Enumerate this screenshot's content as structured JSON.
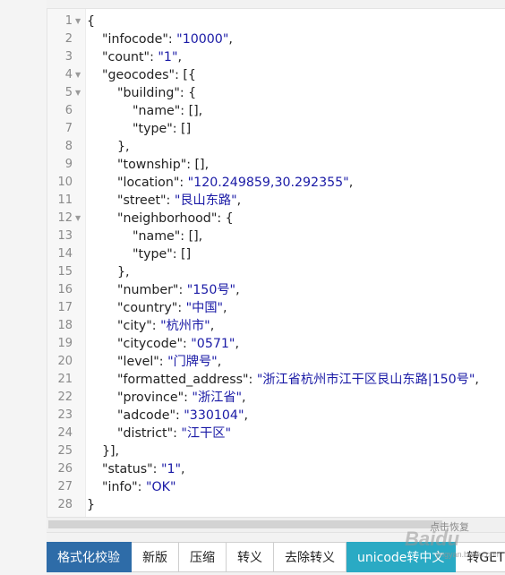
{
  "editor": {
    "lines": [
      {
        "n": "1",
        "fold": true,
        "indent": 0,
        "parts": [
          [
            "p",
            "{"
          ]
        ]
      },
      {
        "n": "2",
        "indent": 1,
        "parts": [
          [
            "k",
            "\"infocode\""
          ],
          [
            "p",
            ": "
          ],
          [
            "s",
            "\"10000\""
          ],
          [
            "p",
            ","
          ]
        ]
      },
      {
        "n": "3",
        "indent": 1,
        "parts": [
          [
            "k",
            "\"count\""
          ],
          [
            "p",
            ": "
          ],
          [
            "s",
            "\"1\""
          ],
          [
            "p",
            ","
          ]
        ]
      },
      {
        "n": "4",
        "fold": true,
        "indent": 1,
        "parts": [
          [
            "k",
            "\"geocodes\""
          ],
          [
            "p",
            ": [{"
          ]
        ]
      },
      {
        "n": "5",
        "fold": true,
        "indent": 2,
        "parts": [
          [
            "k",
            "\"building\""
          ],
          [
            "p",
            ": {"
          ]
        ]
      },
      {
        "n": "6",
        "indent": 3,
        "parts": [
          [
            "k",
            "\"name\""
          ],
          [
            "p",
            ": [],"
          ]
        ]
      },
      {
        "n": "7",
        "indent": 3,
        "parts": [
          [
            "k",
            "\"type\""
          ],
          [
            "p",
            ": []"
          ]
        ]
      },
      {
        "n": "8",
        "indent": 2,
        "parts": [
          [
            "p",
            "},"
          ]
        ]
      },
      {
        "n": "9",
        "indent": 2,
        "parts": [
          [
            "k",
            "\"township\""
          ],
          [
            "p",
            ": [],"
          ]
        ]
      },
      {
        "n": "10",
        "indent": 2,
        "parts": [
          [
            "k",
            "\"location\""
          ],
          [
            "p",
            ": "
          ],
          [
            "s",
            "\"120.249859,30.292355\""
          ],
          [
            "p",
            ","
          ]
        ]
      },
      {
        "n": "11",
        "indent": 2,
        "parts": [
          [
            "k",
            "\"street\""
          ],
          [
            "p",
            ": "
          ],
          [
            "s",
            "\"艮山东路\""
          ],
          [
            "p",
            ","
          ]
        ]
      },
      {
        "n": "12",
        "fold": true,
        "indent": 2,
        "parts": [
          [
            "k",
            "\"neighborhood\""
          ],
          [
            "p",
            ": {"
          ]
        ]
      },
      {
        "n": "13",
        "indent": 3,
        "parts": [
          [
            "k",
            "\"name\""
          ],
          [
            "p",
            ": [],"
          ]
        ]
      },
      {
        "n": "14",
        "indent": 3,
        "parts": [
          [
            "k",
            "\"type\""
          ],
          [
            "p",
            ": []"
          ]
        ]
      },
      {
        "n": "15",
        "indent": 2,
        "parts": [
          [
            "p",
            "},"
          ]
        ]
      },
      {
        "n": "16",
        "indent": 2,
        "parts": [
          [
            "k",
            "\"number\""
          ],
          [
            "p",
            ": "
          ],
          [
            "s",
            "\"150号\""
          ],
          [
            "p",
            ","
          ]
        ]
      },
      {
        "n": "17",
        "indent": 2,
        "parts": [
          [
            "k",
            "\"country\""
          ],
          [
            "p",
            ": "
          ],
          [
            "s",
            "\"中国\""
          ],
          [
            "p",
            ","
          ]
        ]
      },
      {
        "n": "18",
        "indent": 2,
        "parts": [
          [
            "k",
            "\"city\""
          ],
          [
            "p",
            ": "
          ],
          [
            "s",
            "\"杭州市\""
          ],
          [
            "p",
            ","
          ]
        ]
      },
      {
        "n": "19",
        "indent": 2,
        "parts": [
          [
            "k",
            "\"citycode\""
          ],
          [
            "p",
            ": "
          ],
          [
            "s",
            "\"0571\""
          ],
          [
            "p",
            ","
          ]
        ]
      },
      {
        "n": "20",
        "indent": 2,
        "parts": [
          [
            "k",
            "\"level\""
          ],
          [
            "p",
            ": "
          ],
          [
            "s",
            "\"门牌号\""
          ],
          [
            "p",
            ","
          ]
        ]
      },
      {
        "n": "21",
        "indent": 2,
        "parts": [
          [
            "k",
            "\"formatted_address\""
          ],
          [
            "p",
            ": "
          ],
          [
            "s",
            "\"浙江省杭州市江干区艮山东路|150号\""
          ],
          [
            "p",
            ","
          ]
        ]
      },
      {
        "n": "22",
        "indent": 2,
        "parts": [
          [
            "k",
            "\"province\""
          ],
          [
            "p",
            ": "
          ],
          [
            "s",
            "\"浙江省\""
          ],
          [
            "p",
            ","
          ]
        ]
      },
      {
        "n": "23",
        "indent": 2,
        "parts": [
          [
            "k",
            "\"adcode\""
          ],
          [
            "p",
            ": "
          ],
          [
            "s",
            "\"330104\""
          ],
          [
            "p",
            ","
          ]
        ]
      },
      {
        "n": "24",
        "indent": 2,
        "parts": [
          [
            "k",
            "\"district\""
          ],
          [
            "p",
            ": "
          ],
          [
            "s",
            "\"江干区\""
          ]
        ]
      },
      {
        "n": "25",
        "indent": 1,
        "parts": [
          [
            "p",
            "}],"
          ]
        ]
      },
      {
        "n": "26",
        "indent": 1,
        "parts": [
          [
            "k",
            "\"status\""
          ],
          [
            "p",
            ": "
          ],
          [
            "s",
            "\"1\""
          ],
          [
            "p",
            ","
          ]
        ]
      },
      {
        "n": "27",
        "indent": 1,
        "parts": [
          [
            "k",
            "\"info\""
          ],
          [
            "p",
            ": "
          ],
          [
            "s",
            "\"OK\""
          ]
        ]
      },
      {
        "n": "28",
        "indent": 0,
        "parts": [
          [
            "p",
            "}"
          ]
        ]
      }
    ]
  },
  "hint": {
    "restore": "点击恢复"
  },
  "watermark": {
    "logo": "Baidu",
    "sub": "jingyan.baidu.com"
  },
  "toolbar": {
    "format_validate": "格式化校验",
    "new_version": "新版",
    "compress": "压缩",
    "escape": "转义",
    "unescape": "去除转义",
    "unicode_to_cn": "unicode转中文",
    "to_get": "转GET参数"
  },
  "colors": {
    "primary": "#2e6ca8",
    "teal": "#2aaac4",
    "string": "#1a1aa6"
  }
}
